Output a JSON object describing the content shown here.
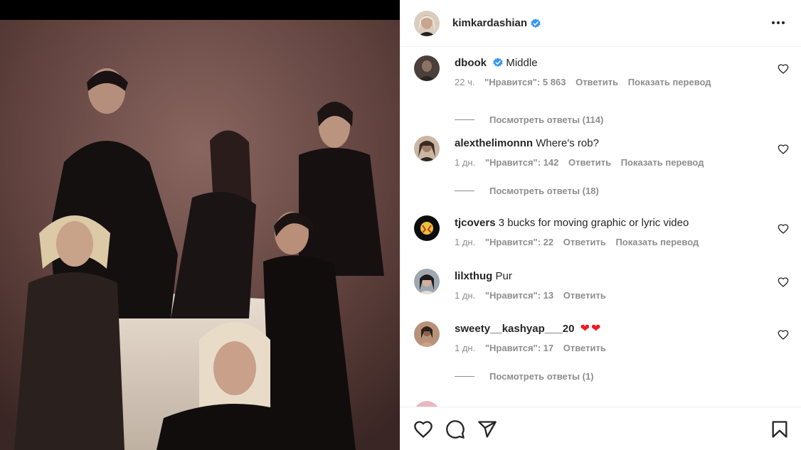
{
  "post": {
    "username": "kimkardashian",
    "verified": true,
    "image_description": "photo"
  },
  "icons": {
    "verified": "verified-badge-icon",
    "more": "more-options-icon",
    "like": "heart-icon",
    "comment": "comment-icon",
    "share": "share-icon",
    "save": "bookmark-icon"
  },
  "colors": {
    "verified": "#3897f0",
    "text": "#262626",
    "muted": "#8e8e8e",
    "heart_emoji": "#ed1c24"
  },
  "comments": [
    {
      "username": "dbook",
      "verified": true,
      "text": "Middle",
      "time": "22 ч.",
      "likes": "\"Нравится\": 5 863",
      "reply": "Ответить",
      "translate": "Показать перевод",
      "view_replies": "Посмотреть ответы (114)"
    },
    {
      "username": "alexthelimonnn",
      "text": "Where's rob?",
      "time": "1 дн.",
      "likes": "\"Нравится\": 142",
      "reply": "Ответить",
      "translate": "Показать перевод",
      "view_replies": "Посмотреть ответы (18)"
    },
    {
      "username": "tjcovers",
      "text": "3 bucks for moving graphic or lyric video",
      "time": "1 дн.",
      "likes": "\"Нравится\": 22",
      "reply": "Ответить",
      "translate": "Показать перевод"
    },
    {
      "username": "lilxthug",
      "text": "Pur",
      "time": "1 дн.",
      "likes": "\"Нравится\": 13",
      "reply": "Ответить"
    },
    {
      "username": "sweety__kashyap___20",
      "text": "❤❤",
      "time": "1 дн.",
      "likes": "\"Нравится\": 17",
      "reply": "Ответить",
      "view_replies": "Посмотреть ответы (1)"
    }
  ]
}
